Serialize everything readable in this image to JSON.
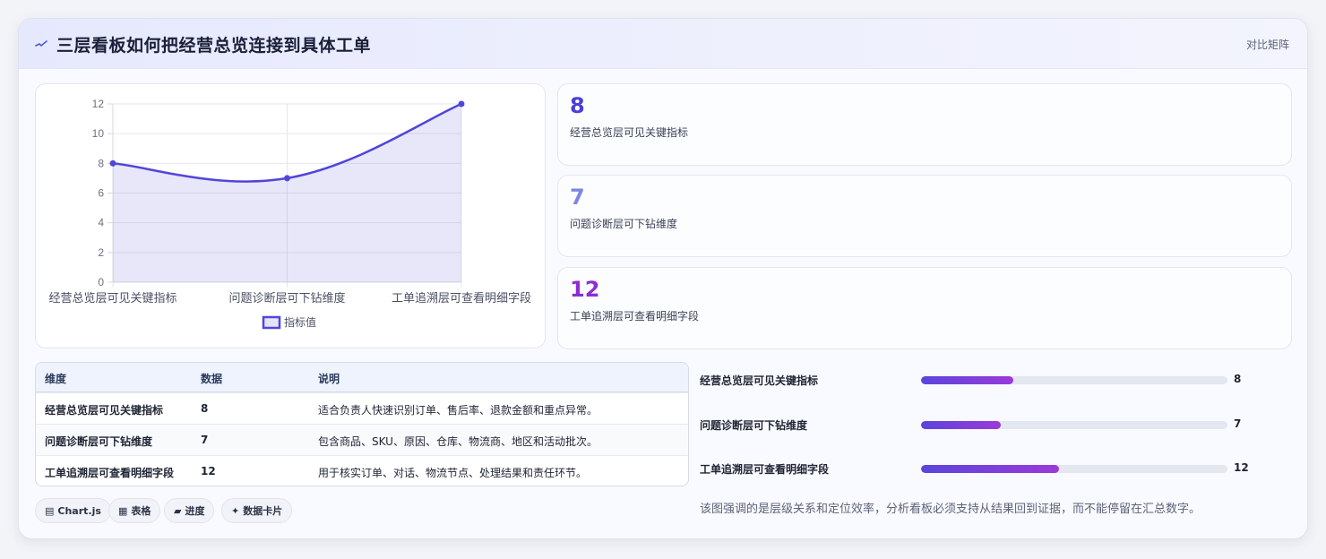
{
  "header": {
    "icon": "pulse-icon",
    "title": "三层看板如何把经营总览连接到具体工单",
    "right_label": "对比矩阵"
  },
  "colors": {
    "accent": "#5046d8",
    "stat1": "#4a3fd6",
    "stat2": "#7d86e0",
    "stat3": "#8b2fd0",
    "progress_from": "#5b45dc",
    "progress_to": "#9b3ad9"
  },
  "chart_data": {
    "type": "line",
    "categories": [
      "经营总览层可见关键指标",
      "问题诊断层可下钻维度",
      "工单追溯层可查看明细字段"
    ],
    "series": [
      {
        "name": "指标值",
        "values": [
          8,
          7,
          12
        ]
      }
    ],
    "y_ticks": [
      0,
      2,
      4,
      6,
      8,
      10,
      12
    ],
    "ylim": [
      0,
      12
    ],
    "fill": true,
    "smooth": true,
    "grid": true,
    "legend_position": "bottom"
  },
  "stats": [
    {
      "value": "8",
      "label": "经营总览层可见关键指标"
    },
    {
      "value": "7",
      "label": "问题诊断层可下钻维度"
    },
    {
      "value": "12",
      "label": "工单追溯层可查看明细字段"
    }
  ],
  "table": {
    "headers": [
      "维度",
      "数据",
      "说明"
    ],
    "rows": [
      [
        "经营总览层可见关键指标",
        "8",
        "适合负责人快速识别订单、售后率、退款金额和重点异常。"
      ],
      [
        "问题诊断层可下钻维度",
        "7",
        "包含商品、SKU、原因、仓库、物流商、地区和活动批次。"
      ],
      [
        "工单追溯层可查看明细字段",
        "12",
        "用于核实订单、对话、物流节点、处理结果和责任环节。"
      ]
    ]
  },
  "chips": [
    {
      "icon": "chart-icon",
      "glyph": "▤",
      "label": "Chart.js"
    },
    {
      "icon": "table-icon",
      "glyph": "▦",
      "label": "表格"
    },
    {
      "icon": "progress-icon",
      "glyph": "▰",
      "label": "进度"
    },
    {
      "icon": "sparkle-icon",
      "glyph": "✦",
      "label": "数据卡片"
    }
  ],
  "progress": [
    {
      "label": "经营总览层可见关键指标",
      "value": "8",
      "fraction": 0.3
    },
    {
      "label": "问题诊断层可下钻维度",
      "value": "7",
      "fraction": 0.26
    },
    {
      "label": "工单追溯层可查看明细字段",
      "value": "12",
      "fraction": 0.45
    }
  ],
  "note": "该图强调的是层级关系和定位效率，分析看板必须支持从结果回到证据，而不能停留在汇总数字。"
}
